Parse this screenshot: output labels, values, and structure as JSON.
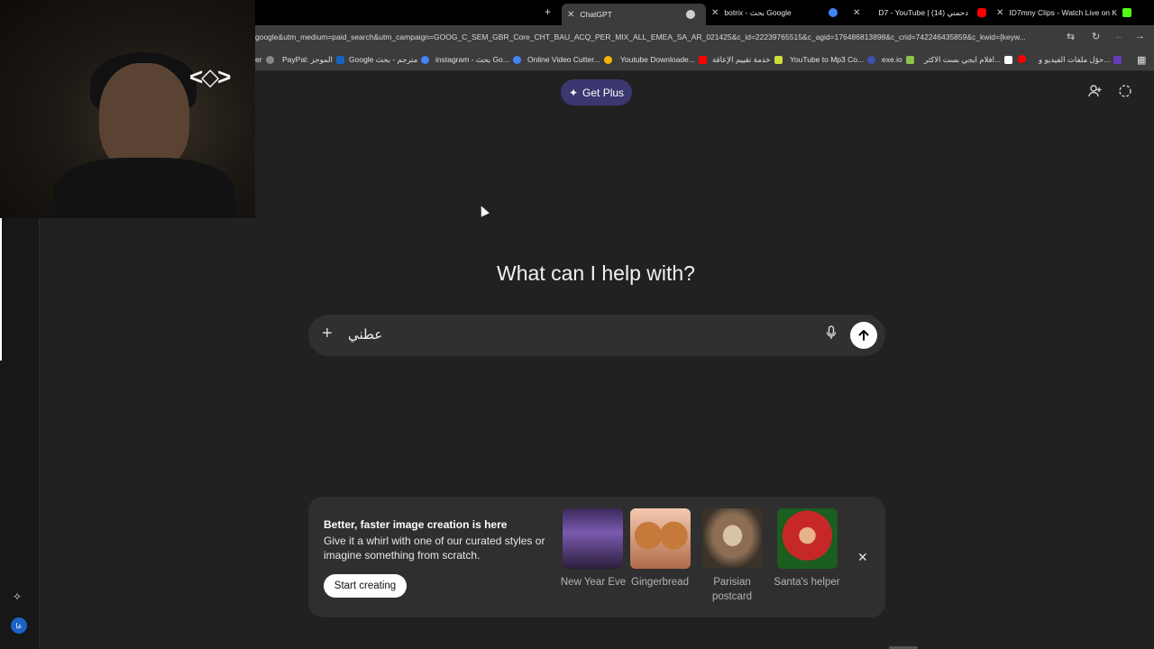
{
  "browser": {
    "tabs": [
      {
        "title": "ChatGPT",
        "favicon_color": "#cfcfcf",
        "active": true
      },
      {
        "title": "botrix - بحث Google",
        "favicon_color": "#4285f4",
        "active": false
      },
      {
        "title": "D7 - YouTube | (14) دحمني",
        "favicon_color": "#ff0000",
        "active": false
      },
      {
        "title": "ID7mny Clips - Watch Live on K",
        "favicon_color": "#53fc18",
        "active": false
      }
    ],
    "new_tab_label": "+",
    "url": "google&utm_medium=paid_search&utm_campaign=GOOG_C_SEM_GBR_Core_CHT_BAU_ACQ_PER_MIX_ALL_EMEA_SA_AR_021425&c_id=22239765515&c_agid=176486813898&c_crid=742246435859&c_kwid={keyw...",
    "bookmarks": [
      {
        "label": "er",
        "color": "#888888"
      },
      {
        "label": "PayPal: الموجز",
        "color": "#1565c0"
      },
      {
        "label": "Google مترجم - بحث",
        "color": "#4285f4"
      },
      {
        "label": "instagram - بحث Go...",
        "color": "#4285f4"
      },
      {
        "label": "Online Video Cutter...",
        "color": "#f4b400"
      },
      {
        "label": "Youtube Downloade...",
        "color": "#ff0000"
      },
      {
        "label": "خدمة تقييم الإعاقة",
        "color": "#cddc39"
      },
      {
        "label": "YouTube to Mp3 Co...",
        "color": "#3f51b5"
      },
      {
        "label": "exe.io",
        "color": "#8bc34a"
      },
      {
        "label": "افلام ايجي بست الاكثر...",
        "color": "#ffffff"
      },
      {
        "label": "",
        "color": "#ff0000"
      },
      {
        "label": "حؤل ملفات الفيديو و...",
        "color": "#673ab7"
      }
    ]
  },
  "header": {
    "get_plus_label": "Get Plus"
  },
  "main": {
    "heading": "What can I help with?",
    "composer_text": "عطني"
  },
  "promo": {
    "title": "Better, faster image creation is here",
    "description": "Give it a whirl with one of our curated styles or imagine something from scratch.",
    "start_label": "Start creating",
    "styles": [
      {
        "caption": "New Year Eve"
      },
      {
        "caption": "Gingerbread"
      },
      {
        "caption": "Parisian postcard"
      },
      {
        "caption": "Santa's helper"
      }
    ]
  },
  "sidebar": {
    "avatar_initials": "عا"
  }
}
